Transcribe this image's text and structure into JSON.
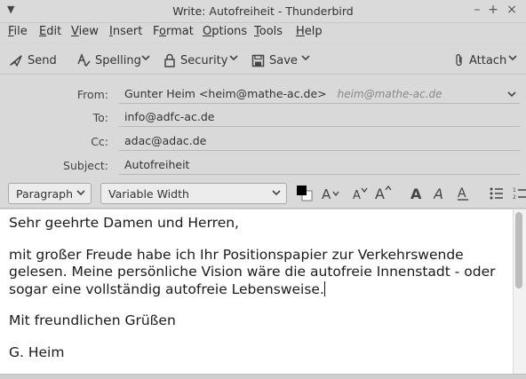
{
  "window": {
    "title": "Write: Autofreiheit - Thunderbird",
    "controls": {
      "minimize": "–",
      "maximize": "+",
      "close": "×"
    }
  },
  "menu": {
    "items": [
      {
        "label": "File",
        "access": "F",
        "rest": "ile"
      },
      {
        "label": "Edit",
        "access": "E",
        "rest": "dit"
      },
      {
        "label": "View",
        "access": "V",
        "rest": "iew"
      },
      {
        "label": "Insert",
        "access": "I",
        "rest": "nsert"
      },
      {
        "label": "Format",
        "access": "o",
        "pre": "F",
        "rest": "rmat"
      },
      {
        "label": "Options",
        "access": "O",
        "rest": "ptions"
      },
      {
        "label": "Tools",
        "access": "T",
        "rest": "ools"
      },
      {
        "label": "Help",
        "access": "H",
        "rest": "elp"
      }
    ]
  },
  "toolbar": {
    "send": "Send",
    "spelling": "Spelling",
    "security": "Security",
    "save": "Save",
    "attach": "Attach"
  },
  "header": {
    "from_label": "From:",
    "from_value": "Gunter Heim <heim@mathe-ac.de>",
    "from_identity": "heim@mathe-ac.de",
    "to_label": "To:",
    "to_value": "info@adfc-ac.de",
    "cc_label": "Cc:",
    "cc_value": "adac@adac.de",
    "subject_label": "Subject:",
    "subject_value": "Autofreiheit"
  },
  "format": {
    "paragraph": "Paragraph",
    "font": "Variable Width"
  },
  "body": {
    "greeting": "Sehr geehrte Damen und Herren,",
    "paragraph": "mit großer Freude habe ich Ihr Positionspapier zur Verkehrswende gelesen. Meine persönliche Vision wäre die autofreie Innenstadt - oder sogar eine vollständig autofreie Lebensweise.",
    "closing": "Mit freundlichen Grüßen",
    "signature": "G. Heim"
  }
}
